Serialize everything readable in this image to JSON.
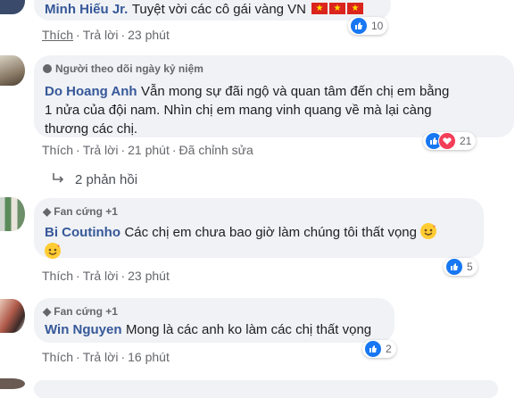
{
  "comments": [
    {
      "author": "Minh Hiếu Jr.",
      "text": "Tuyệt vời các cô gái vàng VN",
      "actions": {
        "like": "Thích",
        "reply": "Trả lời",
        "time": "23 phút"
      },
      "reactions": {
        "count": "10",
        "types": [
          "like"
        ]
      }
    },
    {
      "badge": "Người theo dõi ngày kỷ niệm",
      "author": "Do Hoang Anh",
      "text_line1": "Vẫn mong sự đãi ngộ và quan tâm đến chị em bằng",
      "text_line2": "1 nửa của đội nam. Nhìn chị em mang vinh quang về mà lại càng",
      "text_line3": "thương các chị.",
      "actions": {
        "like": "Thích",
        "reply": "Trả lời",
        "time": "21 phút",
        "edited": "Đã chỉnh sửa"
      },
      "reactions": {
        "count": "21",
        "types": [
          "like",
          "love"
        ]
      },
      "replies_label": "2 phản hồi"
    },
    {
      "badge": "Fan cứng +1",
      "author": "Bi Coutinho",
      "text": "Các chị em chưa bao giờ làm chúng tôi thất vọng",
      "actions": {
        "like": "Thích",
        "reply": "Trả lời",
        "time": "23 phút"
      },
      "reactions": {
        "count": "5",
        "types": [
          "like"
        ]
      }
    },
    {
      "badge": "Fan cứng +1",
      "author": "Win Nguyen",
      "text": "Mong là các anh ko làm các chị thất vọng",
      "actions": {
        "like": "Thích",
        "reply": "Trả lời",
        "time": "16 phút"
      },
      "reactions": {
        "count": "2",
        "types": [
          "like"
        ]
      }
    }
  ],
  "colors": {
    "name": "#365899",
    "bubble": "#f0f2f5",
    "like": "#1877f2",
    "love": "#f33e58"
  }
}
